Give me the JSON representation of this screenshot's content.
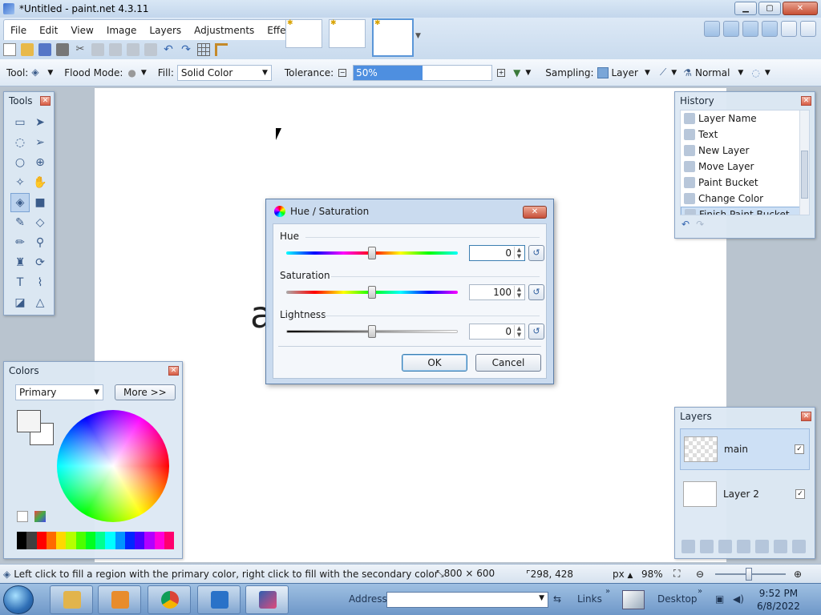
{
  "window": {
    "title": "*Untitled - paint.net 4.3.11"
  },
  "menu": [
    "File",
    "Edit",
    "View",
    "Image",
    "Layers",
    "Adjustments",
    "Effects"
  ],
  "toolbar": {
    "tool_label": "Tool:",
    "flood_mode_label": "Flood Mode:",
    "fill_label": "Fill:",
    "fill_value": "Solid Color",
    "tolerance_label": "Tolerance:",
    "tolerance_value": "50%",
    "tolerance_fraction": 0.5,
    "sampling_label": "Sampling:",
    "sampling_value": "Layer",
    "blend_value": "Normal"
  },
  "canvas": {
    "text": "a"
  },
  "tools_panel": {
    "title": "Tools"
  },
  "history_panel": {
    "title": "History",
    "items": [
      "Layer Name",
      "Text",
      "New Layer",
      "Move Layer",
      "Paint Bucket",
      "Change Color",
      "Finish Paint Bucket"
    ]
  },
  "colors_panel": {
    "title": "Colors",
    "mode": "Primary",
    "more_button": "More >>",
    "palette": [
      "#000000",
      "#404040",
      "#ff0000",
      "#ff6a00",
      "#ffd800",
      "#b6ff00",
      "#4cff00",
      "#00ff21",
      "#00ff90",
      "#00ffff",
      "#0094ff",
      "#0026ff",
      "#4800ff",
      "#b200ff",
      "#ff00dc",
      "#ff006e"
    ]
  },
  "layers_panel": {
    "title": "Layers",
    "layers": [
      "main",
      "Layer 2"
    ]
  },
  "dialog": {
    "title": "Hue / Saturation",
    "hue_label": "Hue",
    "hue_value": "0",
    "saturation_label": "Saturation",
    "saturation_value": "100",
    "lightness_label": "Lightness",
    "lightness_value": "0",
    "ok": "OK",
    "cancel": "Cancel"
  },
  "status": {
    "hint": "Left click to fill a region with the primary color, right click to fill with the secondary color",
    "image_size": "800 × 600",
    "cursor_pos": "298, 428",
    "units": "px",
    "zoom": "98%"
  },
  "taskbar": {
    "address_label": "Address",
    "links_label": "Links",
    "desktop_label": "Desktop",
    "time": "9:52 PM",
    "date": "6/8/2022"
  }
}
